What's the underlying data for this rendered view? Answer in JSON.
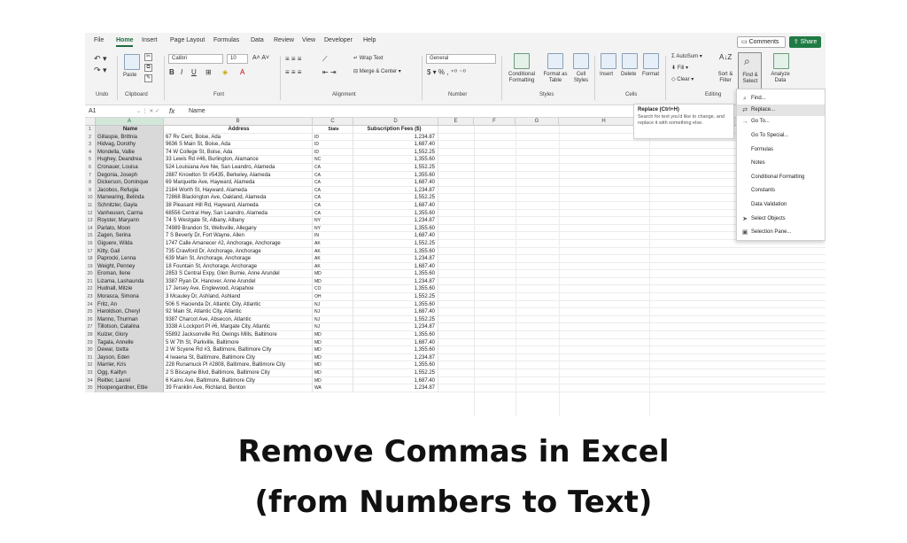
{
  "menu": {
    "tabs": [
      "File",
      "Home",
      "Insert",
      "Page Layout",
      "Formulas",
      "Data",
      "Review",
      "View",
      "Developer",
      "Help"
    ],
    "comments_label": "Comments",
    "share_label": "Share"
  },
  "ribbon": {
    "undo_label": "Undo",
    "clipboard_label": "Clipboard",
    "paste_label": "Paste",
    "font_name": "Calibri",
    "font_size": "10",
    "font_label": "Font",
    "alignment_label": "Alignment",
    "wrap_text": "Wrap Text",
    "merge_center": "Merge & Center",
    "number_format": "General",
    "number_label": "Number",
    "conditional_formatting": "Conditional Formatting",
    "format_as_table": "Format as Table",
    "cell_styles": "Cell Styles",
    "styles_label": "Styles",
    "insert": "Insert",
    "delete": "Delete",
    "format": "Format",
    "cells_label": "Cells",
    "autosum": "AutoSum",
    "fill": "Fill",
    "clear": "Clear",
    "sort_filter": "Sort & Filter",
    "find_select": "Find & Select",
    "analyze_data": "Analyze Data",
    "editing_label": "Editing",
    "accent_color": "#1f7a44"
  },
  "formula_bar": {
    "name_box": "A1",
    "fx": "fx",
    "content": "Name"
  },
  "columns": [
    "A",
    "B",
    "C",
    "D",
    "E",
    "F",
    "G",
    "H"
  ],
  "sheet": {
    "headers": {
      "a": "Name",
      "b": "Address",
      "c": "State",
      "d": "Subscription Fees ($)"
    },
    "rows": [
      {
        "n": "2",
        "a": "Gillaspie, Brittnia",
        "b": "67 Rv Cent, Boise, Ada",
        "c": "ID",
        "d": "1,234.87"
      },
      {
        "n": "3",
        "a": "Hidvag, Dorothy",
        "b": "9636 S Main St, Boise, Ada",
        "c": "ID",
        "d": "1,687.40"
      },
      {
        "n": "4",
        "a": "Mondella, Vallie",
        "b": "74 W College St, Boise, Ada",
        "c": "ID",
        "d": "1,552.25"
      },
      {
        "n": "5",
        "a": "Hughey, Deandrea",
        "b": "33 Lewis Rd #46, Burlington, Alamance",
        "c": "NC",
        "d": "1,355.60"
      },
      {
        "n": "6",
        "a": "Cronauer, Louisa",
        "b": "524 Louisiana Ave Nw, San Leandro, Alameda",
        "c": "CA",
        "d": "1,552.25"
      },
      {
        "n": "7",
        "a": "Degonia, Joseph",
        "b": "2887 Knowlton St #5435, Berkeley, Alameda",
        "c": "CA",
        "d": "1,355.60"
      },
      {
        "n": "8",
        "a": "Dickerson, Dominque",
        "b": "69 Marquette Ave, Hayward, Alameda",
        "c": "CA",
        "d": "1,687.40"
      },
      {
        "n": "9",
        "a": "Jacobos, Refugia",
        "b": "2184 Worth St, Hayward, Alameda",
        "c": "CA",
        "d": "1,234.87"
      },
      {
        "n": "10",
        "a": "Manwaring, Belinda",
        "b": "72868 Blackington Ave, Oakland, Alameda",
        "c": "CA",
        "d": "1,552.25"
      },
      {
        "n": "11",
        "a": "Schnitzler, Gayla",
        "b": "38 Pleasant Hill Rd, Hayward, Alameda",
        "c": "CA",
        "d": "1,687.40"
      },
      {
        "n": "12",
        "a": "Vanheusen, Carma",
        "b": "68556 Central Hwy, San Leandro, Alameda",
        "c": "CA",
        "d": "1,355.60"
      },
      {
        "n": "13",
        "a": "Royster, Maryann",
        "b": "74 S Westgate St, Albany, Albany",
        "c": "NY",
        "d": "1,234.87"
      },
      {
        "n": "14",
        "a": "Parlato, Moon",
        "b": "74989 Brandon St, Wellsville, Allegany",
        "c": "NY",
        "d": "1,355.60"
      },
      {
        "n": "15",
        "a": "Zagen, Serina",
        "b": "7 S Beverly Dr, Fort Wayne, Allen",
        "c": "IN",
        "d": "1,687.40"
      },
      {
        "n": "16",
        "a": "Giguere, Wilda",
        "b": "1747 Calle Amanecer #2, Anchorage, Anchorage",
        "c": "AK",
        "d": "1,552.25"
      },
      {
        "n": "17",
        "a": "Kitty, Gail",
        "b": "735 Crawford Dr, Anchorage, Anchorage",
        "c": "AK",
        "d": "1,355.60"
      },
      {
        "n": "18",
        "a": "Paprocki, Lenna",
        "b": "639 Main St, Anchorage, Anchorage",
        "c": "AK",
        "d": "1,234.87"
      },
      {
        "n": "19",
        "a": "Weight, Penney",
        "b": "18 Fountain St, Anchorage, Anchorage",
        "c": "AK",
        "d": "1,687.40"
      },
      {
        "n": "20",
        "a": "Eroman, Ilene",
        "b": "2853 S Central Expy, Glen Burnie, Anne Arundel",
        "c": "MD",
        "d": "1,355.60"
      },
      {
        "n": "21",
        "a": "Lizama, Lashaunda",
        "b": "3387 Ryan Dr, Hanover, Anne Arundel",
        "c": "MD",
        "d": "1,234.87"
      },
      {
        "n": "22",
        "a": "Hudnall, Mitzie",
        "b": "17 Jersey Ave, Englewood, Arapahoe",
        "c": "CO",
        "d": "1,355.60"
      },
      {
        "n": "23",
        "a": "Morasca, Simona",
        "b": "3 Mcauley Dr, Ashland, Ashland",
        "c": "OH",
        "d": "1,552.25"
      },
      {
        "n": "24",
        "a": "Fritz, An",
        "b": "506 S Hacienda Dr, Atlantic City, Atlantic",
        "c": "NJ",
        "d": "1,355.60"
      },
      {
        "n": "25",
        "a": "Haroldson, Cheryl",
        "b": "92 Main St, Atlantic City, Atlantic",
        "c": "NJ",
        "d": "1,687.40"
      },
      {
        "n": "26",
        "a": "Manno, Thurman",
        "b": "9387 Charcot Ave, Absecon, Atlantic",
        "c": "NJ",
        "d": "1,552.25"
      },
      {
        "n": "27",
        "a": "Tillotson, Catalina",
        "b": "3338 A Lockport Pl #6, Margate City, Atlantic",
        "c": "NJ",
        "d": "1,234.87"
      },
      {
        "n": "28",
        "a": "Kulzer, Glory",
        "b": "55892 Jacksonville Rd, Owings Mills, Baltimore",
        "c": "MD",
        "d": "1,355.60"
      },
      {
        "n": "29",
        "a": "Tagala, Annelle",
        "b": "5 W 7th St, Parkville, Baltimore",
        "c": "MD",
        "d": "1,687.40"
      },
      {
        "n": "30",
        "a": "Dewar, Izetta",
        "b": "2 W Scyene Rd #3, Baltimore, Baltimore City",
        "c": "MD",
        "d": "1,355.60"
      },
      {
        "n": "31",
        "a": "Jayson, Eden",
        "b": "4 Iwaena St, Baltimore, Baltimore City",
        "c": "MD",
        "d": "1,234.87"
      },
      {
        "n": "32",
        "a": "Marrier, Kris",
        "b": "228 Runamuck Pl #2808, Baltimore, Baltimore City",
        "c": "MD",
        "d": "1,355.60"
      },
      {
        "n": "33",
        "a": "Ogg, Kaitlyn",
        "b": "2 S Biscayne Blvd, Baltimore, Baltimore City",
        "c": "MD",
        "d": "1,552.25"
      },
      {
        "n": "34",
        "a": "Reitler, Laurel",
        "b": "6 Kains Ave, Baltimore, Baltimore City",
        "c": "MD",
        "d": "1,687.40"
      },
      {
        "n": "35",
        "a": "Hoopengardner, Ettie",
        "b": "39 Franklin Ave, Richland, Benton",
        "c": "WA",
        "d": "1,234.87"
      }
    ]
  },
  "tooltip": {
    "title": "Replace (Ctrl+H)",
    "body": "Search for text you'd like to change, and replace it with something else."
  },
  "find_menu": {
    "items": [
      "Find...",
      "Replace...",
      "Go To...",
      "Go To Special...",
      "Formulas",
      "Notes",
      "Conditional Formatting",
      "Constants",
      "Data Validation",
      "Select Objects",
      "Selection Pane..."
    ],
    "icons": [
      "search-icon",
      "replace-icon",
      "arrow-right-icon",
      "",
      "",
      "",
      "",
      "",
      "",
      "cursor-icon",
      "selection-pane-icon"
    ],
    "highlighted_index": 1
  },
  "caption": {
    "line1": "Remove Commas in Excel",
    "line2": "(from Numbers to Text)"
  }
}
